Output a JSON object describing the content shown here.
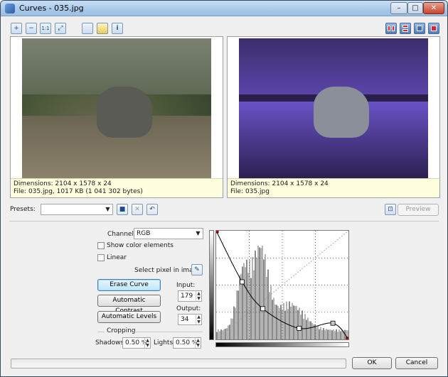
{
  "window": {
    "title": "Curves - 035.jpg"
  },
  "titlebar": {
    "minimize_glyph": "–",
    "maximize_glyph": "□",
    "close_glyph": "✕"
  },
  "toolbar": {
    "zoom_in_glyph": "+",
    "zoom_out_glyph": "−",
    "actual_size_glyph": "1:1",
    "fit_glyph": "⤢",
    "info_glyph": "i"
  },
  "preview": {
    "original": {
      "info_line1": "Dimensions: 2104 x 1578 x 24",
      "info_line2": "File: 035.jpg, 1017 KB (1 041 302 bytes)"
    },
    "result": {
      "info_line1": "Dimensions: 2104 x 1578 x 24",
      "info_line2": "File: 035.jpg"
    }
  },
  "presets": {
    "label": "Presets:",
    "value": "",
    "preview_label": "Preview"
  },
  "channel": {
    "label": "Channel:",
    "value": "RGB"
  },
  "options": {
    "show_color_elements": "Show color elements",
    "linear": "Linear",
    "select_pixel": "Select pixel in image:"
  },
  "buttons": {
    "erase_curve": "Erase Curve",
    "automatic_contrast": "Automatic Contrast",
    "automatic_levels": "Automatic Levels"
  },
  "input": {
    "label": "Input:",
    "value": "179"
  },
  "output": {
    "label": "Output:",
    "value": "34"
  },
  "cropping": {
    "title": "Cropping",
    "shadows_label": "Shadows:",
    "shadows_value": "0.50",
    "lights_label": "Lights:",
    "lights_value": "0.50",
    "unit": "%"
  },
  "dialog": {
    "ok_label": "OK",
    "cancel_label": "Cancel"
  },
  "progress": {
    "fraction": 0
  },
  "curve": {
    "points": [
      [
        0,
        255
      ],
      [
        50,
        135
      ],
      [
        90,
        72
      ],
      [
        160,
        26
      ],
      [
        225,
        38
      ],
      [
        255,
        0
      ]
    ],
    "selected_point": [
      225,
      38
    ]
  },
  "colors": {
    "accent": "#3c7fb1",
    "curve_endpoint": "#c00000"
  }
}
